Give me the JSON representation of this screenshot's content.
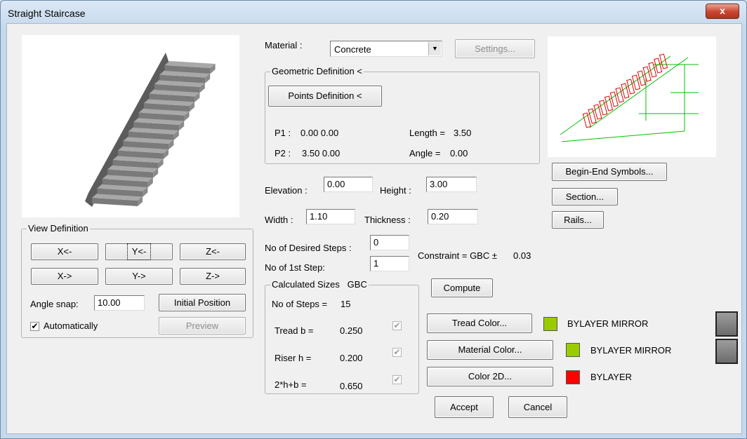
{
  "window": {
    "title": "Straight Staircase",
    "close_symbol": "x"
  },
  "material": {
    "label": "Material :",
    "value": "Concrete",
    "settings_label": "Settings..."
  },
  "geometric": {
    "title": "Geometric Definition <",
    "points_button": "Points Definition <",
    "p1_label": "P1 :",
    "p1_value": "0.00 0.00",
    "p2_label": "P2 :",
    "p2_value": "3.50 0.00",
    "length_label": "Length =",
    "length_value": "3.50",
    "angle_label": "Angle =",
    "angle_value": "0.00"
  },
  "buttons_right": {
    "begin_end": "Begin-End Symbols...",
    "section": "Section...",
    "rails": "Rails..."
  },
  "dimensions": {
    "elevation_label": "Elevation :",
    "elevation_value": "0.00",
    "height_label": "Height :",
    "height_value": "3.00",
    "width_label": "Width :",
    "width_value": "1.10",
    "thickness_label": "Thickness :",
    "thickness_value": "0.20"
  },
  "steps": {
    "desired_label": "No of Desired Steps :",
    "desired_value": "0",
    "first_label": "No of 1st Step:",
    "first_value": "1",
    "constraint_label": "Constraint = GBC ±",
    "constraint_value": "0.03",
    "compute_label": "Compute"
  },
  "calculated": {
    "title": "Calculated Sizes",
    "standard": "GBC",
    "steps_label": "No of Steps =",
    "steps_value": "15",
    "tread_label": "Tread b =",
    "tread_value": "0.250",
    "tread_checked": true,
    "riser_label": "Riser h =",
    "riser_value": "0.200",
    "riser_checked": true,
    "formula_label": "2*h+b =",
    "formula_value": "0.650",
    "formula_checked": true
  },
  "colors": {
    "tread_button": "Tread Color...",
    "tread_text": "BYLAYER MIRROR",
    "tread_swatch": "#99cc00",
    "material_button": "Material Color...",
    "material_text": "BYLAYER MIRROR",
    "material_swatch": "#99cc00",
    "color2d_button": "Color 2D...",
    "color2d_text": "BYLAYER",
    "color2d_swatch": "#ff0000"
  },
  "view_definition": {
    "title": "View Definition",
    "x_minus": "X<-",
    "y_minus": "Y<-",
    "z_minus": "Z<-",
    "x_plus": "X->",
    "y_plus": "Y->",
    "z_plus": "Z->",
    "angle_label": "Angle snap:",
    "angle_value": "10.00",
    "initial_position": "Initial Position",
    "auto_label": "Automatically",
    "auto_checked": true,
    "preview_label": "Preview"
  },
  "footer": {
    "accept": "Accept",
    "cancel": "Cancel"
  }
}
